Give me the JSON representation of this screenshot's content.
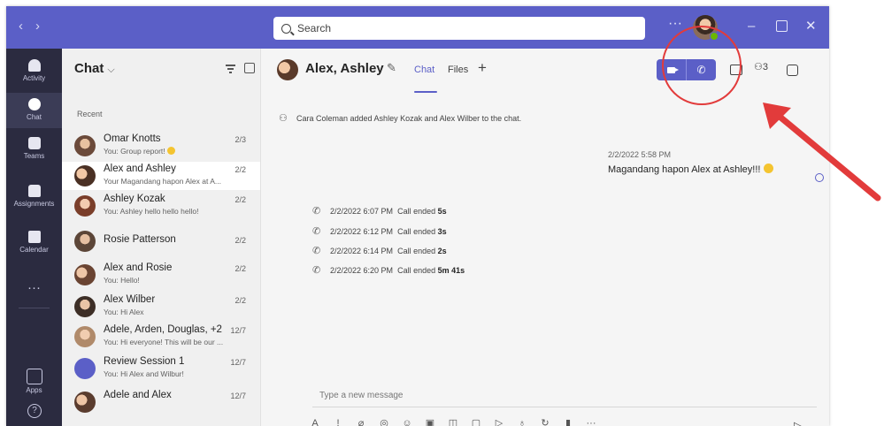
{
  "titlebar": {
    "search_placeholder": "Search",
    "more": "···"
  },
  "rail": {
    "items": [
      {
        "label": "Activity",
        "icon": "bell-icon"
      },
      {
        "label": "Chat",
        "icon": "chat-icon"
      },
      {
        "label": "Teams",
        "icon": "teams-icon"
      },
      {
        "label": "Assignments",
        "icon": "assignments-icon"
      },
      {
        "label": "Calendar",
        "icon": "calendar-icon"
      }
    ],
    "more": "···",
    "apps": "Apps"
  },
  "chatlist": {
    "title": "Chat",
    "section": "Recent",
    "items": [
      {
        "name": "Omar Knotts",
        "preview": "You: Group report!",
        "date": "2/3"
      },
      {
        "name": "Alex and Ashley",
        "preview": "Your Magandang hapon Alex at A...",
        "date": "2/2"
      },
      {
        "name": "Ashley Kozak",
        "preview": "You: Ashley hello hello hello!",
        "date": "2/2"
      },
      {
        "name": "Rosie Patterson",
        "preview": "",
        "date": "2/2"
      },
      {
        "name": "Alex and Rosie",
        "preview": "You: Hello!",
        "date": "2/2"
      },
      {
        "name": "Alex Wilber",
        "preview": "You: Hi Alex",
        "date": "2/2"
      },
      {
        "name": "Adele, Arden, Douglas, +2",
        "preview": "You: Hi everyone! This will be our ...",
        "date": "12/7"
      },
      {
        "name": "Review Session 1",
        "preview": "You: Hi Alex and Wilbur!",
        "date": "12/7"
      },
      {
        "name": "Adele and Alex",
        "preview": "",
        "date": "12/7"
      }
    ]
  },
  "header": {
    "title": "Alex, Ashley",
    "tab_chat": "Chat",
    "tab_files": "Files",
    "add_tab": "+",
    "people_count": "3"
  },
  "messages": {
    "system": "Cara Coleman added Ashley Kozak and Alex Wilber to the chat.",
    "outgoing": {
      "meta": "2/2/2022 5:58 PM",
      "text": "Magandang hapon Alex at Ashley!!!"
    },
    "calls": [
      {
        "time": "2/2/2022 6:07 PM",
        "label": "Call ended",
        "duration": "5s"
      },
      {
        "time": "2/2/2022 6:12 PM",
        "label": "Call ended",
        "duration": "3s"
      },
      {
        "time": "2/2/2022 6:14 PM",
        "label": "Call ended",
        "duration": "2s"
      },
      {
        "time": "2/2/2022 6:20 PM",
        "label": "Call ended",
        "duration": "5m 41s"
      }
    ]
  },
  "compose": {
    "placeholder": "Type a new message"
  },
  "colors": {
    "brand": "#5b5fc7",
    "rail": "#2b2b40",
    "annotation": "#e23b3b"
  }
}
